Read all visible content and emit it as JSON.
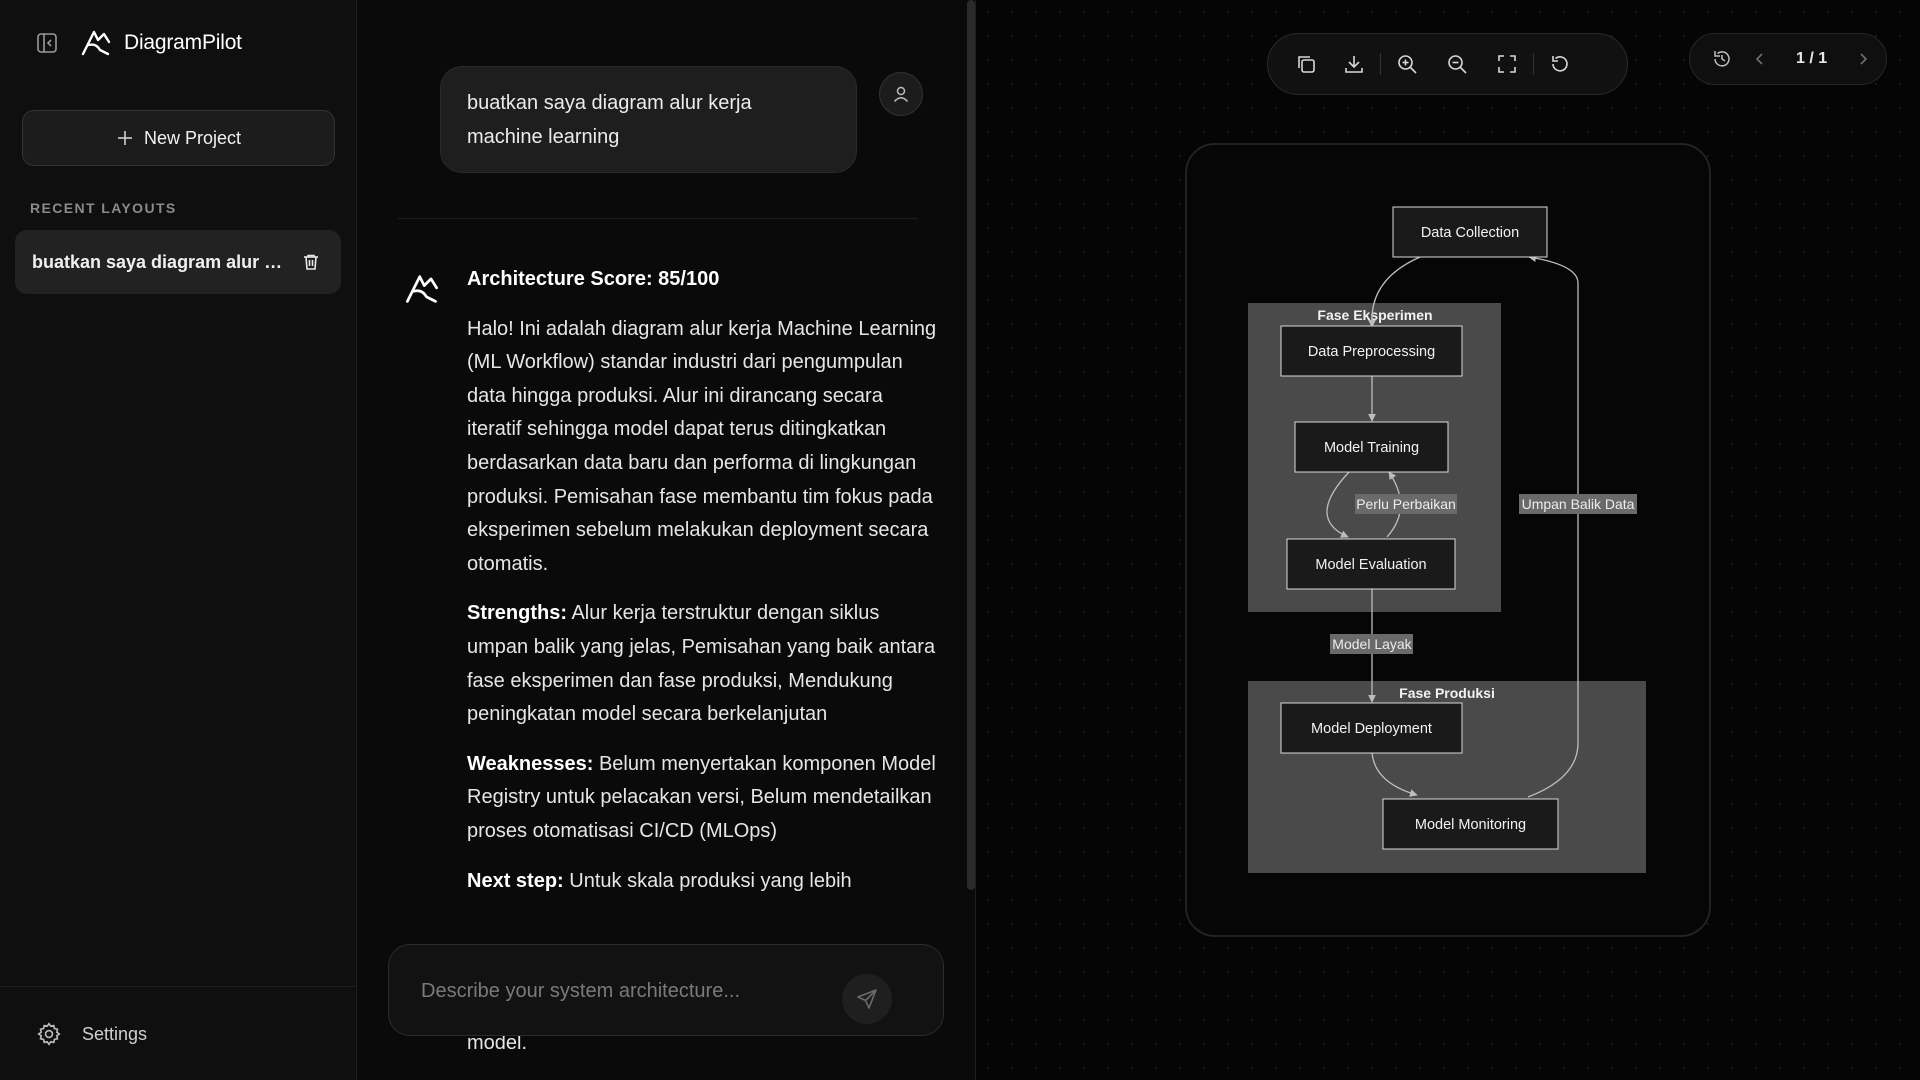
{
  "sidebar": {
    "brand": "DiagramPilot",
    "new_project_label": "New Project",
    "recent_label": "RECENT LAYOUTS",
    "recent_items": [
      {
        "label": "buatkan saya diagram alur k..."
      }
    ],
    "settings_label": "Settings"
  },
  "chat": {
    "user_message": "buatkan saya diagram alur kerja machine learning",
    "bot": {
      "score": "Architecture Score: 85/100",
      "intro": "Halo! Ini adalah diagram alur kerja Machine Learning (ML Workflow) standar industri dari pengumpulan data hingga produksi. Alur ini dirancang secara iteratif sehingga model dapat terus ditingkatkan berdasarkan data baru dan performa di lingkungan produksi. Pemisahan fase membantu tim fokus pada eksperimen sebelum melakukan deployment secara otomatis.",
      "strengths_label": "Strengths:",
      "strengths_text": " Alur kerja terstruktur dengan siklus umpan balik yang jelas, Pemisahan yang baik antara fase eksperimen dan fase produksi, Mendukung peningkatan model secara berkelanjutan",
      "weaknesses_label": "Weaknesses:",
      "weaknesses_text": " Belum menyertakan komponen Model Registry untuk pelacakan versi, Belum mendetailkan proses otomatisasi CI/CD (MLOps)",
      "next_label": "Next step:",
      "next_text": " Untuk skala produksi yang lebih",
      "tail": "model."
    },
    "input_placeholder": "Describe your system architecture..."
  },
  "canvas": {
    "pager_text": "1 / 1",
    "diagram": {
      "nodes": {
        "data_collection": "Data Collection",
        "data_preprocessing": "Data Preprocessing",
        "model_training": "Model Training",
        "model_evaluation": "Model Evaluation",
        "model_deployment": "Model Deployment",
        "model_monitoring": "Model Monitoring"
      },
      "groups": {
        "experiment": "Fase Eksperimen",
        "production": "Fase Produksi"
      },
      "edge_labels": {
        "needs_fix": "Perlu Perbaikan",
        "feedback": "Umpan Balik Data",
        "model_ok": "Model Layak"
      }
    }
  },
  "icons": {
    "sidebar_toggle": "sidebar-toggle-icon",
    "logo": "logo-icon",
    "plus": "plus-icon",
    "trash": "trash-icon",
    "gear": "gear-icon",
    "user": "user-icon",
    "send": "send-icon",
    "copy": "copy-icon",
    "download": "download-icon",
    "zoom_in": "zoom-in-icon",
    "zoom_out": "zoom-out-icon",
    "fullscreen": "fullscreen-icon",
    "reset": "reset-icon",
    "history": "history-icon",
    "prev": "chevron-left-icon",
    "next": "chevron-right-icon"
  },
  "colors": {
    "background": "#0a0a0a",
    "panel": "#0f0f0f",
    "group_fill": "#4a4a4a",
    "node_fill": "#1a1a1a",
    "label_bg": "#6a6a6a"
  }
}
